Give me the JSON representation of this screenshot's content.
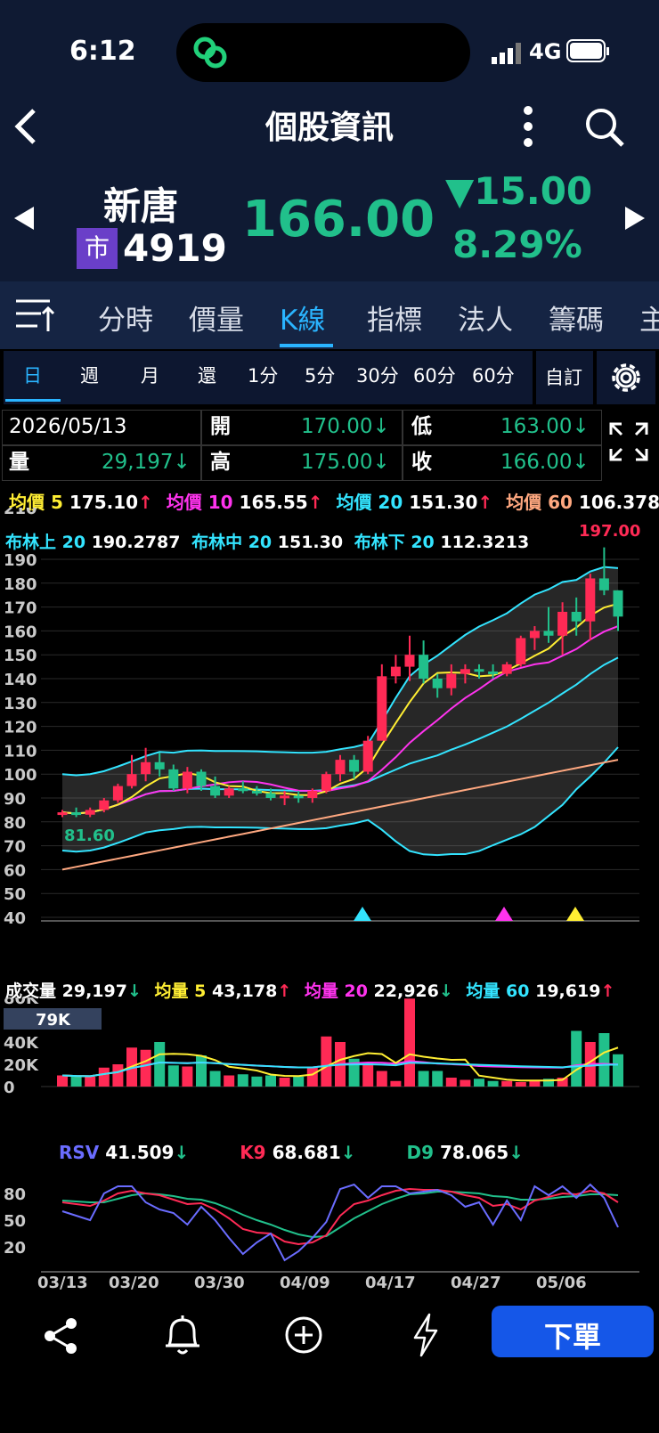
{
  "status": {
    "time": "6:12",
    "network": "4G"
  },
  "nav": {
    "title": "個股資訊"
  },
  "stock": {
    "name": "新唐",
    "market_badge": "市",
    "code": "4919",
    "price": "166.00",
    "change": "▼15.00",
    "change_pct": "8.29%"
  },
  "tabs": [
    "分時",
    "價量",
    "K線",
    "指標",
    "法人",
    "籌碼",
    "主"
  ],
  "active_tab": "K線",
  "periods": [
    "日",
    "週",
    "月",
    "還",
    "1分",
    "5分",
    "30分",
    "60分",
    "60分"
  ],
  "custom_label": "自訂",
  "quote": {
    "date": "2026/05/13",
    "volume_label": "量",
    "volume": "29,197↓",
    "open_label": "開",
    "open": "170.00↓",
    "high_label": "高",
    "high": "175.00↓",
    "low_label": "低",
    "low": "163.00↓",
    "close_label": "收",
    "close": "166.00↓"
  },
  "ma": {
    "ma5_label": "均價 5",
    "ma5": "175.10",
    "ma5_arrow": "↑",
    "ma10_label": "均價 10",
    "ma10": "165.55",
    "ma10_arrow": "↑",
    "ma20_label": "均價 20",
    "ma20": "151.30",
    "ma20_arrow": "↑",
    "ma60_label": "均價 60",
    "ma60": "106.3783"
  },
  "bollinger": {
    "upper_label": "布林上 20",
    "upper": "190.2787",
    "mid_label": "布林中 20",
    "mid": "151.30",
    "lower_label": "布林下 20",
    "lower": "112.3213"
  },
  "price_chart": {
    "high_mark": "197.00",
    "low_mark": "81.60"
  },
  "volume_info": {
    "label": "成交量",
    "value": "29,197",
    "value_arrow": "↓",
    "ma5_label": "均量 5",
    "ma5": "43,178",
    "ma5_arrow": "↑",
    "ma20_label": "均量 20",
    "ma20": "22,926",
    "ma20_arrow": "↓",
    "ma60_label": "均量 60",
    "ma60": "19,619",
    "ma60_arrow": "↑",
    "hover_badge": "79K"
  },
  "kd_info": {
    "rsv_label": "RSV",
    "rsv": "41.509",
    "rsv_arrow": "↓",
    "k_label": "K9",
    "k": "68.681",
    "k_arrow": "↓",
    "d_label": "D9",
    "d": "78.065",
    "d_arrow": "↓"
  },
  "chart_data": {
    "type": "candlestick",
    "x_ticks": [
      "03/13",
      "03/20",
      "03/30",
      "04/09",
      "04/17",
      "04/27",
      "05/06"
    ],
    "price_y_ticks": [
      40,
      50,
      60,
      70,
      80,
      90,
      100,
      110,
      120,
      130,
      140,
      150,
      160,
      170,
      180,
      190,
      210
    ],
    "volume_y_ticks": [
      "0",
      "20K",
      "40K",
      "80K"
    ],
    "kd_y_ticks": [
      20,
      50,
      80
    ],
    "candles": [
      [
        83,
        85,
        82,
        84
      ],
      [
        84,
        86,
        82,
        83
      ],
      [
        83,
        86,
        82,
        85
      ],
      [
        85,
        90,
        84,
        89
      ],
      [
        89,
        96,
        88,
        95
      ],
      [
        95,
        108,
        94,
        100
      ],
      [
        100,
        111,
        97,
        105
      ],
      [
        105,
        109,
        99,
        102
      ],
      [
        102,
        104,
        93,
        94
      ],
      [
        94,
        103,
        92,
        101
      ],
      [
        101,
        102,
        93,
        95
      ],
      [
        95,
        99,
        90,
        91
      ],
      [
        91,
        95,
        90,
        94
      ],
      [
        94,
        97,
        92,
        93
      ],
      [
        93,
        95,
        91,
        92
      ],
      [
        92,
        94,
        89,
        90
      ],
      [
        90,
        93,
        87,
        91
      ],
      [
        91,
        93,
        88,
        90
      ],
      [
        90,
        94,
        88,
        93
      ],
      [
        93,
        101,
        92,
        100
      ],
      [
        100,
        108,
        97,
        106
      ],
      [
        106,
        108,
        98,
        101
      ],
      [
        101,
        116,
        100,
        114
      ],
      [
        114,
        146,
        142,
        141
      ],
      [
        141,
        150,
        138,
        145
      ],
      [
        145,
        158,
        139,
        150
      ],
      [
        150,
        156,
        138,
        140
      ],
      [
        140,
        142,
        132,
        136
      ],
      [
        136,
        146,
        133,
        142
      ],
      [
        142,
        146,
        138,
        144
      ],
      [
        144,
        146,
        140,
        143
      ],
      [
        143,
        146,
        140,
        142
      ],
      [
        142,
        147,
        141,
        146
      ],
      [
        146,
        158,
        145,
        157
      ],
      [
        157,
        162,
        152,
        160
      ],
      [
        160,
        170,
        155,
        158
      ],
      [
        158,
        172,
        150,
        168
      ],
      [
        168,
        174,
        158,
        164
      ],
      [
        164,
        184,
        156,
        182
      ],
      [
        182,
        195,
        175,
        177
      ],
      [
        177,
        172,
        160,
        166
      ]
    ],
    "volume_values": [
      10,
      9,
      9,
      17,
      20,
      35,
      33,
      40,
      19,
      18,
      28,
      14,
      10,
      11,
      9,
      10,
      8,
      9,
      18,
      45,
      40,
      25,
      22,
      14,
      5,
      79,
      14,
      14,
      8,
      6,
      7,
      5,
      5,
      4,
      6,
      7,
      8,
      50,
      40,
      48,
      29
    ],
    "rsv_values": [
      60,
      55,
      50,
      80,
      88,
      88,
      70,
      62,
      58,
      45,
      65,
      50,
      30,
      12,
      25,
      35,
      5,
      15,
      30,
      48,
      85,
      90,
      75,
      88,
      88,
      80,
      82,
      84,
      78,
      65,
      70,
      45,
      72,
      50,
      88,
      78,
      88,
      75,
      90,
      75,
      42
    ],
    "k_values": [
      70,
      68,
      66,
      72,
      80,
      83,
      80,
      78,
      73,
      68,
      69,
      62,
      52,
      40,
      36,
      35,
      26,
      23,
      25,
      33,
      55,
      68,
      72,
      78,
      83,
      85,
      84,
      84,
      82,
      78,
      75,
      66,
      68,
      62,
      72,
      76,
      80,
      79,
      83,
      80,
      70
    ],
    "d_values": [
      72,
      71,
      70,
      70,
      74,
      78,
      80,
      79,
      77,
      74,
      73,
      69,
      63,
      56,
      50,
      45,
      39,
      34,
      31,
      32,
      42,
      52,
      60,
      68,
      74,
      79,
      80,
      82,
      82,
      81,
      80,
      77,
      76,
      73,
      73,
      74,
      76,
      77,
      79,
      79,
      78
    ]
  },
  "bottom_bar": {
    "order_button": "下單"
  },
  "colors": {
    "up": "#ff2a55",
    "down": "#21c08b",
    "accent": "#2ab4ff",
    "order_button": "#1557e8",
    "ma5": "#ffee33",
    "ma10": "#ff33ee",
    "ma20": "#33e4ff",
    "ma60": "#ffa880"
  }
}
